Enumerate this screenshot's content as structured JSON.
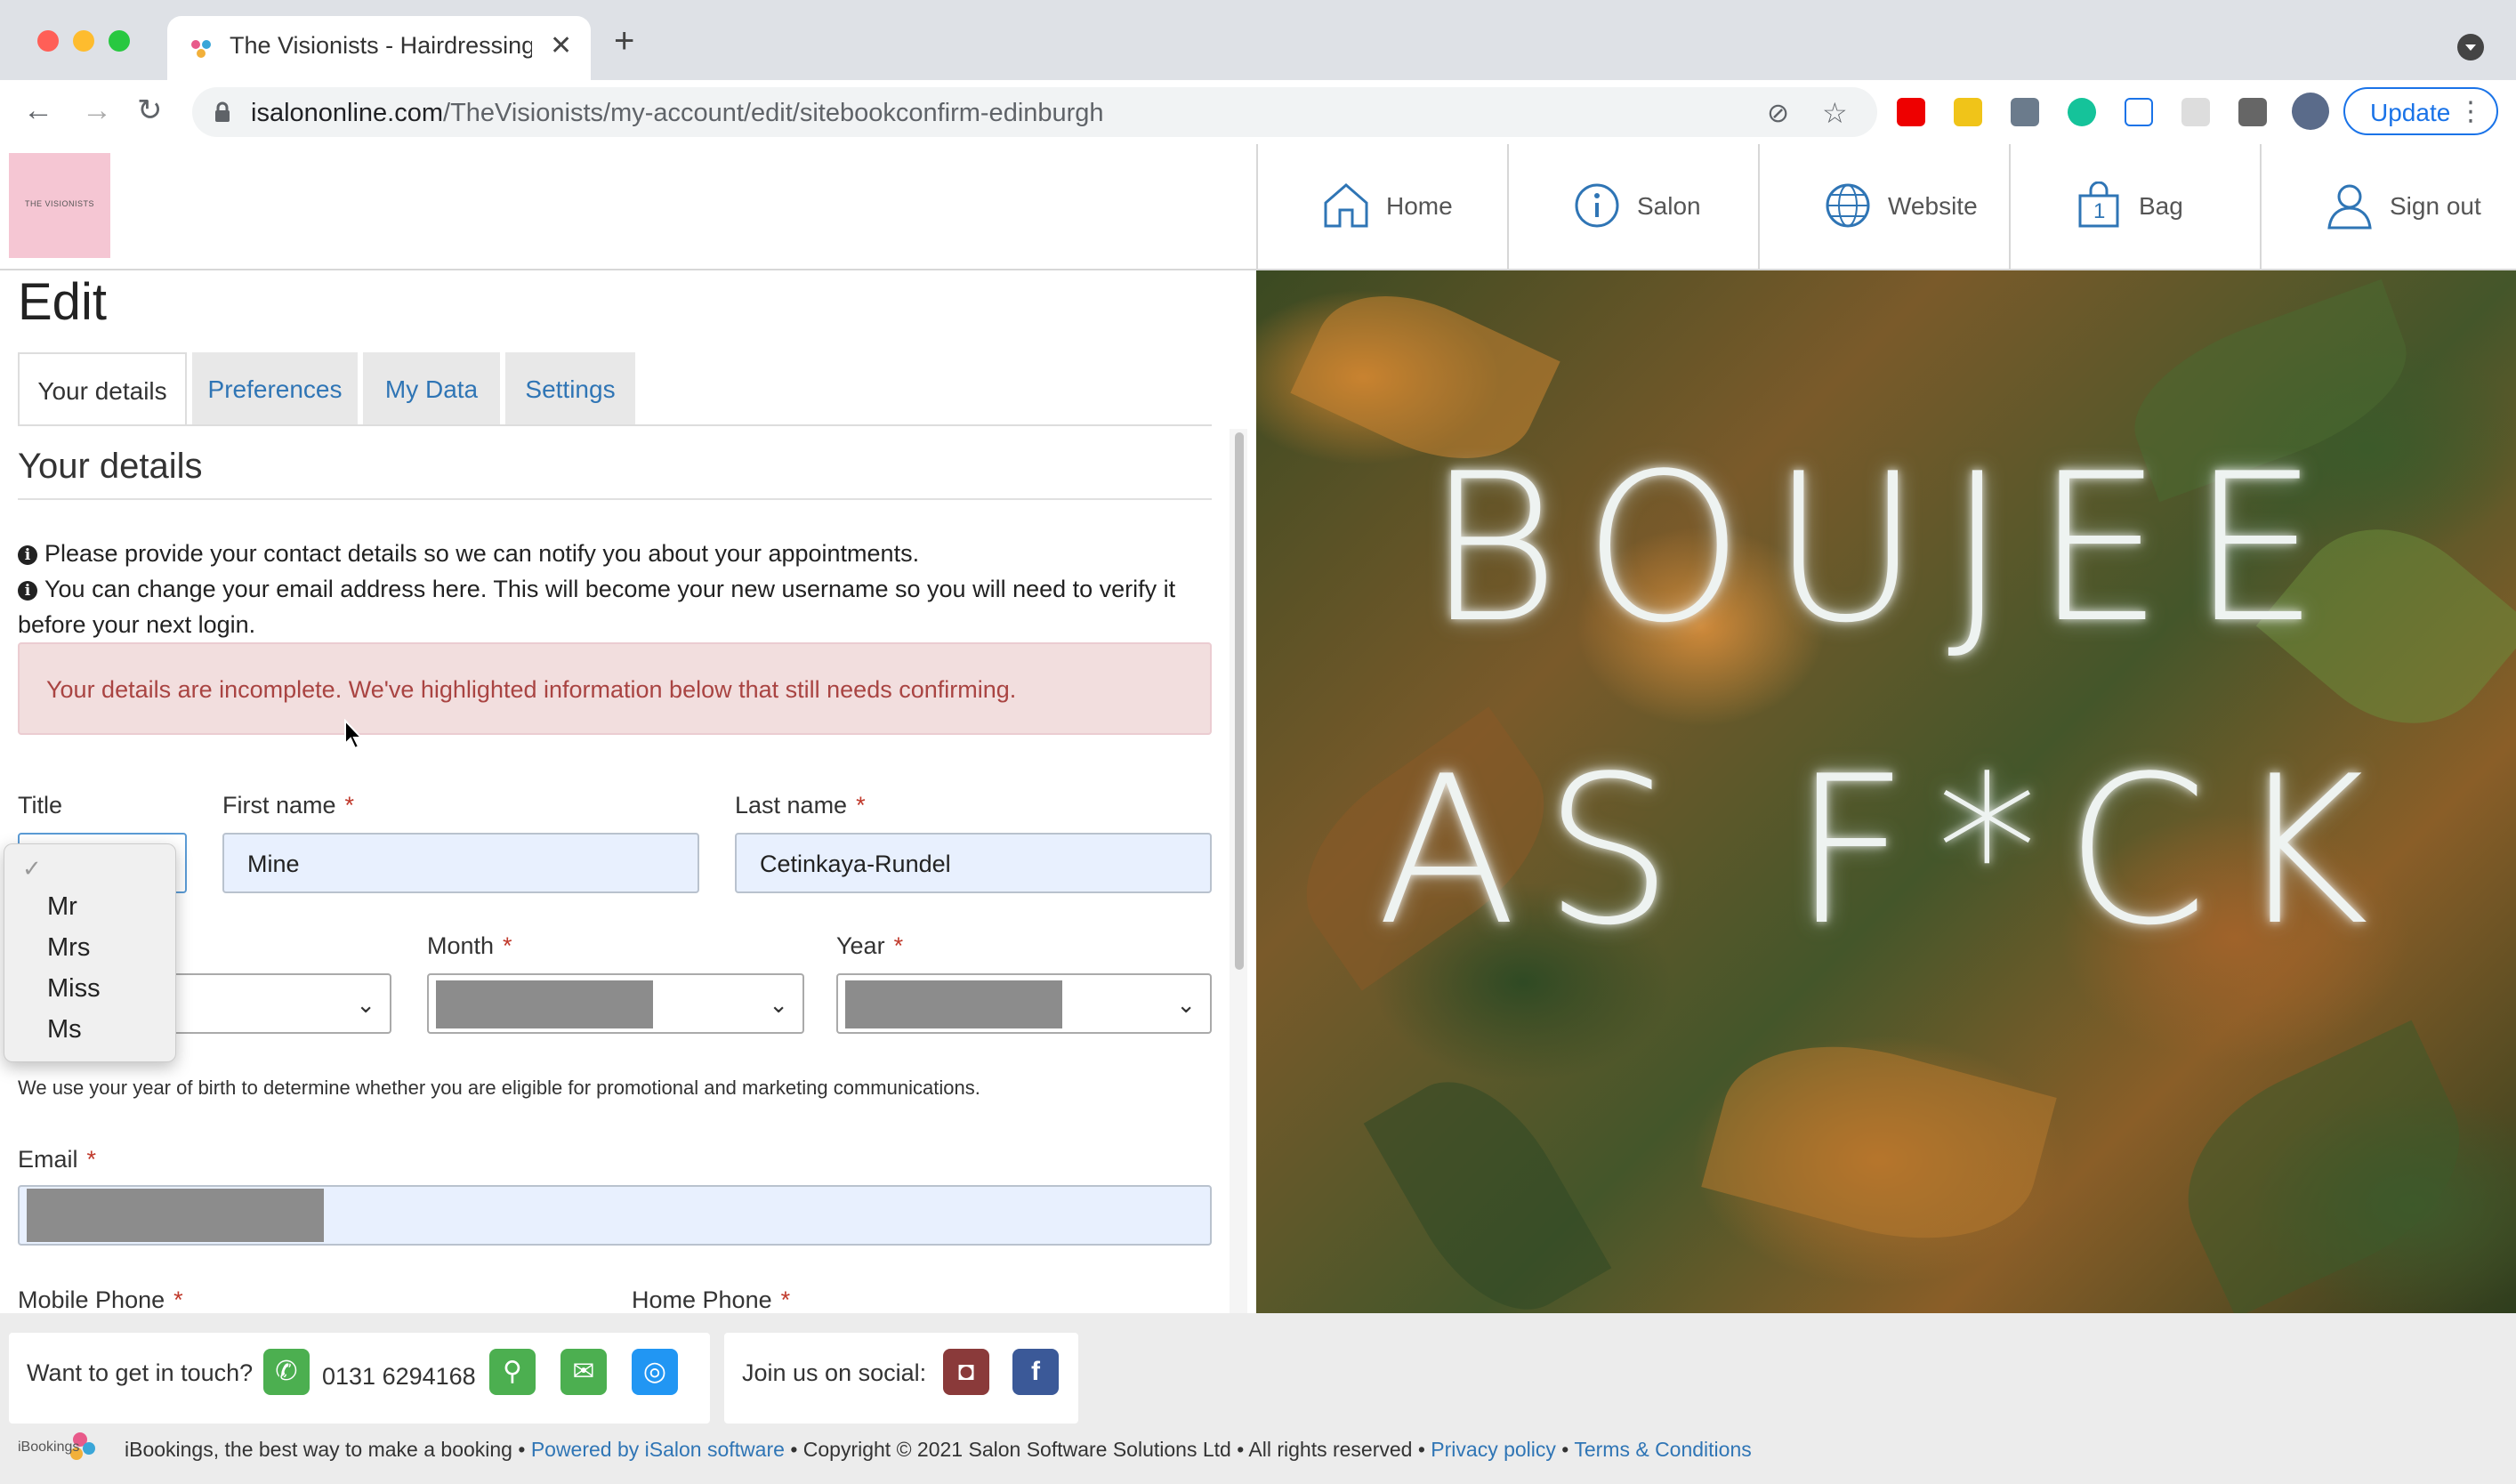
{
  "browser": {
    "tab_title": "The Visionists - Hairdressing a",
    "url_host": "isalononline.com",
    "url_path": "/TheVisionists/my-account/edit/sitebookconfirm-edinburgh",
    "update_label": "Update"
  },
  "site": {
    "logo_text": "THE VISIONISTS",
    "nav": {
      "home": "Home",
      "salon": "Salon",
      "website": "Website",
      "bag": "Bag",
      "bag_count": "1",
      "signout": "Sign out"
    }
  },
  "page": {
    "title": "Edit",
    "tabs": {
      "your_details": "Your details",
      "preferences": "Preferences",
      "my_data": "My Data",
      "settings": "Settings"
    },
    "section_title": "Your details",
    "info1": "Please provide your contact details so we can notify you about your appointments.",
    "info2": "You can change your email address here. This will become your new username so you will need to verify it before your next login.",
    "alert": "Your details are incomplete. We've highlighted information below that still needs confirming."
  },
  "form": {
    "title_label": "Title",
    "first_name_label": "First name",
    "first_name_value": "Mine",
    "last_name_label": "Last name",
    "last_name_value": "Cetinkaya-Rundel",
    "month_label": "Month",
    "year_label": "Year",
    "required_mark": "*",
    "yob_note": "We use your year of birth to determine whether you are eligible for promotional and marketing communications.",
    "email_label": "Email",
    "mobile_label": "Mobile Phone",
    "home_label": "Home Phone",
    "title_options": [
      "Mr",
      "Mrs",
      "Miss",
      "Ms"
    ],
    "check_mark": "✓"
  },
  "hero": {
    "line1": "BOUJEE",
    "line2": "AS F*CK"
  },
  "footer": {
    "contact_label": "Want to get in touch?",
    "phone": "0131 6294168",
    "social_label": "Join us on social:",
    "ib_logo": "iBookings",
    "text_prefix": "iBookings, the best way to make a booking •",
    "powered": "Powered by iSalon software",
    "copyright": "• Copyright © 2021 Salon Software Solutions Ltd • All rights reserved •",
    "privacy": "Privacy policy",
    "sep": "•",
    "terms": "Terms & Conditions"
  }
}
